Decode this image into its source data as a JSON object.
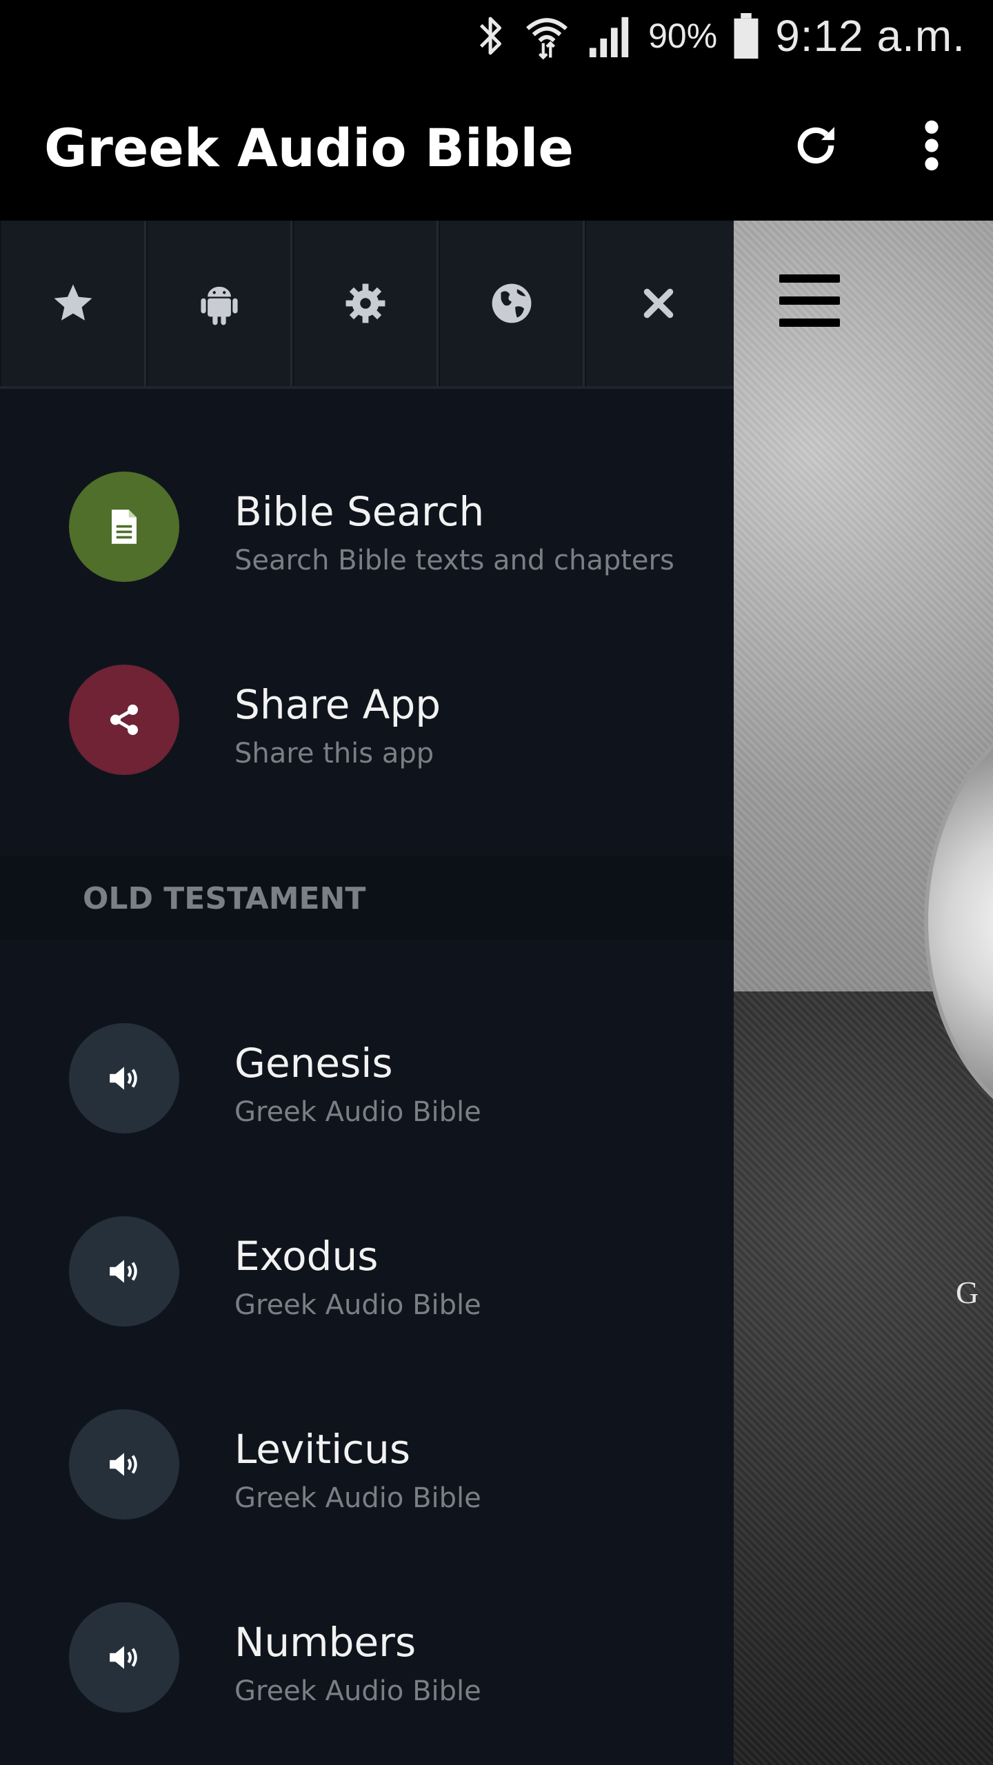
{
  "status_bar": {
    "battery": "90%",
    "time": "9:12 a.m."
  },
  "app_bar": {
    "title": "Greek Audio Bible",
    "icons": [
      "refresh-icon",
      "more-vert-icon"
    ]
  },
  "drawer": {
    "toolbar": {
      "icons": [
        "star-icon",
        "android-icon",
        "gear-icon",
        "globe-icon",
        "close-icon"
      ]
    },
    "top_items": [
      {
        "title": "Bible Search",
        "subtitle": "Search Bible texts and chapters",
        "icon": "document-icon",
        "color": "#4f6f2a"
      },
      {
        "title": "Share App",
        "subtitle": "Share this app",
        "icon": "share-icon",
        "color": "#6f2334"
      }
    ],
    "section": "OLD TESTAMENT",
    "books": [
      {
        "title": "Genesis",
        "subtitle": "Greek Audio Bible"
      },
      {
        "title": "Exodus",
        "subtitle": "Greek Audio Bible"
      },
      {
        "title": "Leviticus",
        "subtitle": "Greek Audio Bible"
      },
      {
        "title": "Numbers",
        "subtitle": "Greek Audio Bible"
      }
    ],
    "book_icon": "speaker-icon",
    "book_icon_color": "#25303b"
  },
  "content": {
    "menu_icon": "hamburger-icon",
    "partial_text": "G"
  }
}
